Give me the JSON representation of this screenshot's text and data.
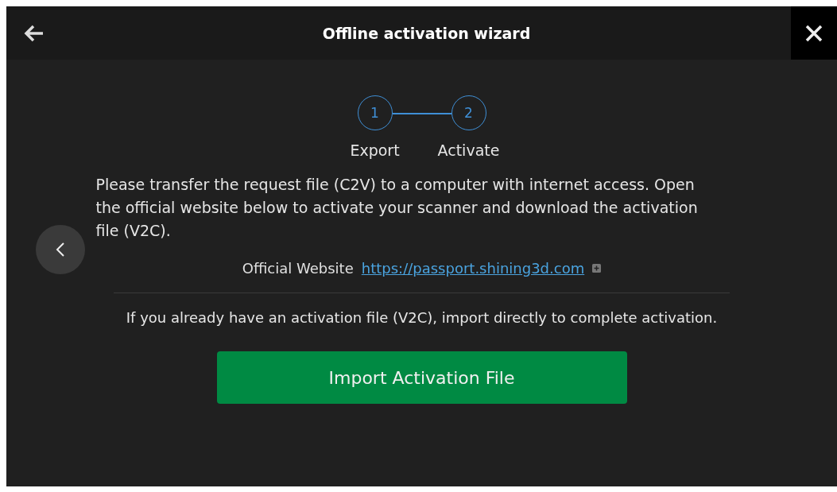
{
  "window": {
    "title": "Offline activation wizard"
  },
  "steps": [
    {
      "number": "1",
      "label": "Export"
    },
    {
      "number": "2",
      "label": "Activate"
    }
  ],
  "instructions": "Please transfer the request file (C2V) to a computer with internet access. Open the official website below to activate your scanner and download the activation file (V2C).",
  "website": {
    "label": "Official Website",
    "link": "https://passport.shining3d.com"
  },
  "note": "If you already have an activation file (V2C), import directly to complete activation.",
  "import_button": "Import Activation File"
}
